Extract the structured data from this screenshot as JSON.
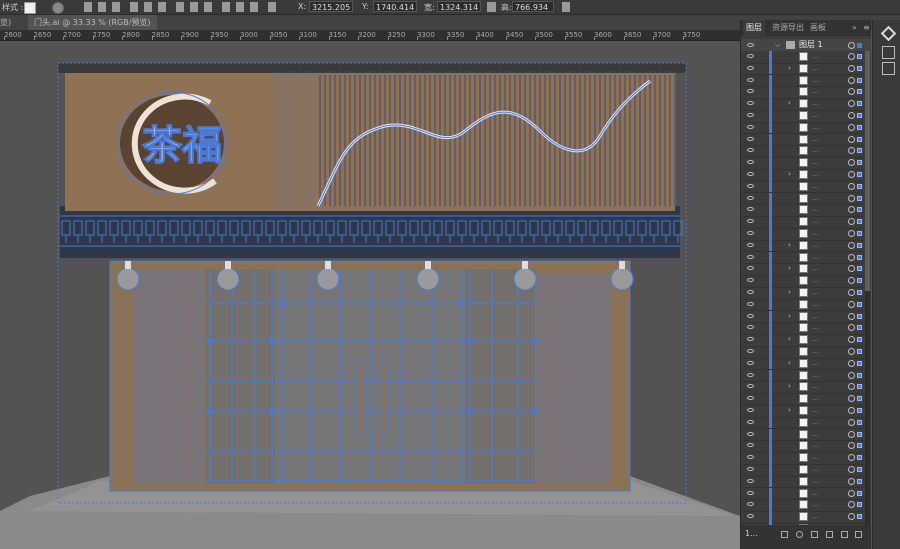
{
  "control_bar": {
    "style_label": "样式 :",
    "x_label": "X:",
    "x_value": "3215.205",
    "y_label": "Y:",
    "y_value": "1740.414",
    "w_label": "宽:",
    "w_value": "1324.314",
    "h_label": "高:",
    "h_value": "766.934"
  },
  "tabs": {
    "prev_label": "览)",
    "active_label": "门头.ai @ 33.33 % (RGB/预览)",
    "close": "×"
  },
  "ruler": {
    "ticks": [
      "2600",
      "2650",
      "2700",
      "2750",
      "2800",
      "2850",
      "2900",
      "2950",
      "3000",
      "3050",
      "3100",
      "3150",
      "3200",
      "3250",
      "3300",
      "3350",
      "3400",
      "3450",
      "3500",
      "3550",
      "3600",
      "3650",
      "3700",
      "3750"
    ]
  },
  "panel": {
    "tabs": [
      "图层",
      "资源导出",
      "画板"
    ],
    "collapse": "»",
    "menu": "≡",
    "layer_name": "图层 1",
    "layer_count": "1...",
    "sublayer_dots": "...",
    "accent": "#4a79d8"
  },
  "artwork": {
    "sign_text": "茶福"
  },
  "colors": {
    "bg": "#535353",
    "wall": "#8a7256",
    "signboard": "#8f7254",
    "selection": "#4a79d8"
  }
}
